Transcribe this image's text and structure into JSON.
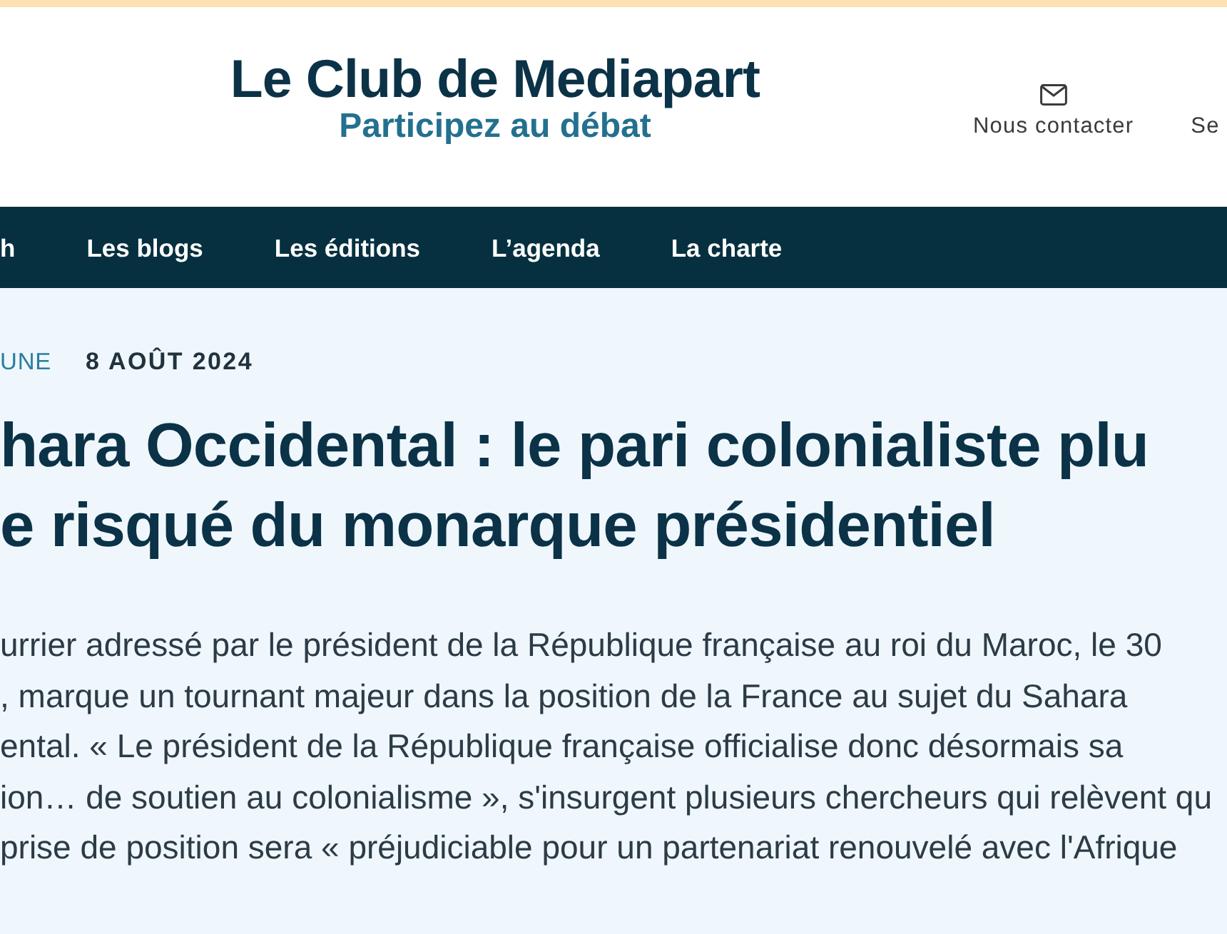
{
  "header": {
    "title": "Le Club de Mediapart",
    "subtitle": "Participez au débat",
    "links": [
      {
        "label": "Nous contacter",
        "kind": "mail"
      },
      {
        "label": "Se",
        "kind": "text"
      }
    ]
  },
  "nav": {
    "items": [
      {
        "label": "h"
      },
      {
        "label": "Les blogs"
      },
      {
        "label": "Les éditions"
      },
      {
        "label": "L’agenda"
      },
      {
        "label": "La charte"
      }
    ]
  },
  "article": {
    "section": "UNE",
    "date": "8 AOÛT 2024",
    "headline_lines": [
      "hara Occidental : le pari colonialiste plu",
      "e risqué du monarque présidentiel"
    ],
    "lede_lines": [
      "urrier adressé par le président de la République française au roi du Maroc, le 30",
      ", marque un tournant majeur dans la position de la France au sujet du Sahara",
      "ental. « Le président de la République française officialise donc désormais sa",
      "ion… de soutien au colonialisme », s'insurgent plusieurs chercheurs qui relèvent qu",
      "prise de position sera « préjudiciable pour un partenariat renouvelé avec l'Afrique"
    ]
  }
}
